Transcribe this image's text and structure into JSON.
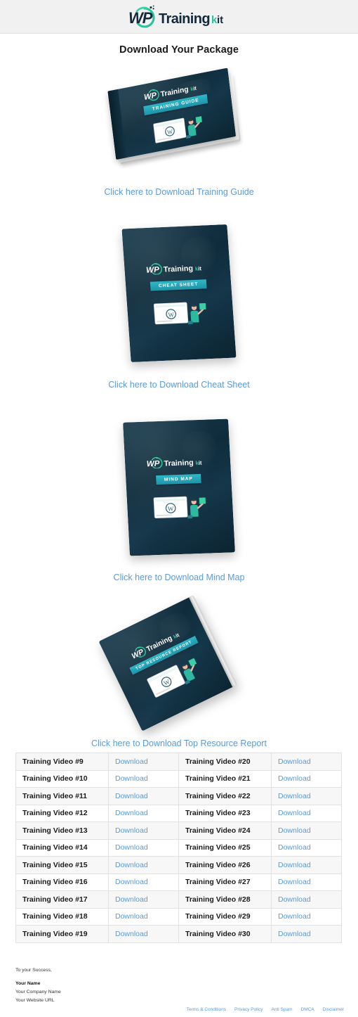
{
  "brand": {
    "logo_wp": "WP",
    "logo_training": "Training",
    "logo_kit": "kit",
    "colors": {
      "navy": "#13293d",
      "teal": "#2fc4a8",
      "green": "#36c98d",
      "link_blue": "#5b9bd5",
      "header_band": "#f1f1f1",
      "cover_dark": "#0f2c3c",
      "badge_teal": "#2fb8c8"
    }
  },
  "page": {
    "title": "Download Your Package"
  },
  "products": [
    {
      "id": "training-guide",
      "badge": "TRAINING GUIDE",
      "link_label": "Click here to Download Training Guide",
      "mockup": "3d-hardcover-flat-angled"
    },
    {
      "id": "cheat-sheet",
      "badge": "CHEAT SHEET",
      "link_label": "Click here to Download Cheat Sheet",
      "mockup": "flat-document-tilted"
    },
    {
      "id": "mind-map",
      "badge": "MIND MAP",
      "link_label": "Click here to Download Mind Map",
      "mockup": "flat-document-tilted"
    },
    {
      "id": "top-resource-report",
      "badge": "TOP RESOURCE REPORT",
      "link_label": "Click here to Download Top Resource Report",
      "mockup": "book-rotated"
    }
  ],
  "videos_table": {
    "download_label": "Download",
    "rows": [
      {
        "left_title": "Training Video #9",
        "left_link": "Download",
        "right_title": "Training Video #20",
        "right_link": "Download"
      },
      {
        "left_title": "Training Video #10",
        "left_link": "Download",
        "right_title": "Training Video #21",
        "right_link": "Download"
      },
      {
        "left_title": "Training Video #11",
        "left_link": "Download",
        "right_title": "Training Video #22",
        "right_link": "Download"
      },
      {
        "left_title": "Training Video #12",
        "left_link": "Download",
        "right_title": "Training Video #23",
        "right_link": "Download"
      },
      {
        "left_title": "Training Video #13",
        "left_link": "Download",
        "right_title": "Training Video #24",
        "right_link": "Download"
      },
      {
        "left_title": "Training Video #14",
        "left_link": "Download",
        "right_title": "Training Video #25",
        "right_link": "Download"
      },
      {
        "left_title": "Training Video #15",
        "left_link": "Download",
        "right_title": "Training Video #26",
        "right_link": "Download"
      },
      {
        "left_title": "Training Video #16",
        "left_link": "Download",
        "right_title": "Training Video #27",
        "right_link": "Download"
      },
      {
        "left_title": "Training Video #17",
        "left_link": "Download",
        "right_title": "Training Video #28",
        "right_link": "Download"
      },
      {
        "left_title": "Training Video #18",
        "left_link": "Download",
        "right_title": "Training Video #29",
        "right_link": "Download"
      },
      {
        "left_title": "Training Video #19",
        "left_link": "Download",
        "right_title": "Training Video #30",
        "right_link": "Download"
      }
    ]
  },
  "signature": {
    "greeting": "To your Success,",
    "name": "Your Name",
    "company": "Your Company Name",
    "website": "Your Website URL"
  },
  "footer": {
    "links": [
      {
        "label": "Terms & Conditions"
      },
      {
        "label": "Privacy Policy"
      },
      {
        "label": "Anti Spam"
      },
      {
        "label": "DMCA"
      },
      {
        "label": "Disclaimer"
      }
    ]
  }
}
